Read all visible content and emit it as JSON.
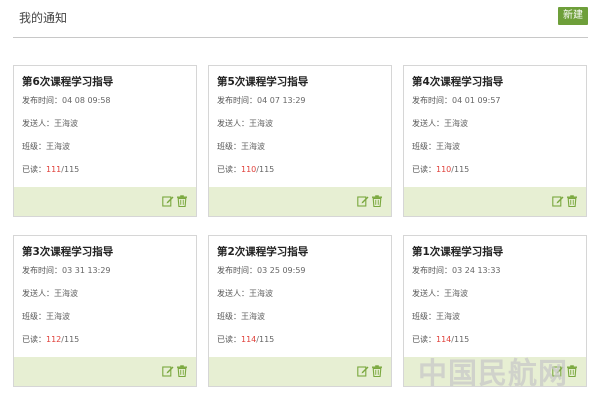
{
  "header": {
    "title": "我的通知",
    "new_label": "新建"
  },
  "labels": {
    "time": "发布时间：",
    "sender": "发送人：",
    "class": "班级：",
    "read": "已读："
  },
  "cards": [
    {
      "title": "第6次课程学习指导",
      "time": "04 08 09:58",
      "sender": "王海波",
      "class": "王海波",
      "read": "111",
      "total": "/115"
    },
    {
      "title": "第5次课程学习指导",
      "time": "04 07 13:29",
      "sender": "王海波",
      "class": "王海波",
      "read": "110",
      "total": "/115"
    },
    {
      "title": "第4次课程学习指导",
      "time": "04 01 09:57",
      "sender": "王海波",
      "class": "王海波",
      "read": "110",
      "total": "/115"
    },
    {
      "title": "第3次课程学习指导",
      "time": "03 31 13:29",
      "sender": "王海波",
      "class": "王海波",
      "read": "112",
      "total": "/115"
    },
    {
      "title": "第2次课程学习指导",
      "time": "03 25 09:59",
      "sender": "王海波",
      "class": "王海波",
      "read": "114",
      "total": "/115"
    },
    {
      "title": "第1次课程学习指导",
      "time": "03 24 13:33",
      "sender": "王海波",
      "class": "王海波",
      "read": "114",
      "total": "/115"
    }
  ],
  "watermark": "中国民航网",
  "colors": {
    "accent": "#6e9f3a",
    "footer": "#e7efd3",
    "read_count": "#e0403a"
  },
  "icons": {
    "edit": "edit-icon",
    "delete": "trash-icon"
  }
}
